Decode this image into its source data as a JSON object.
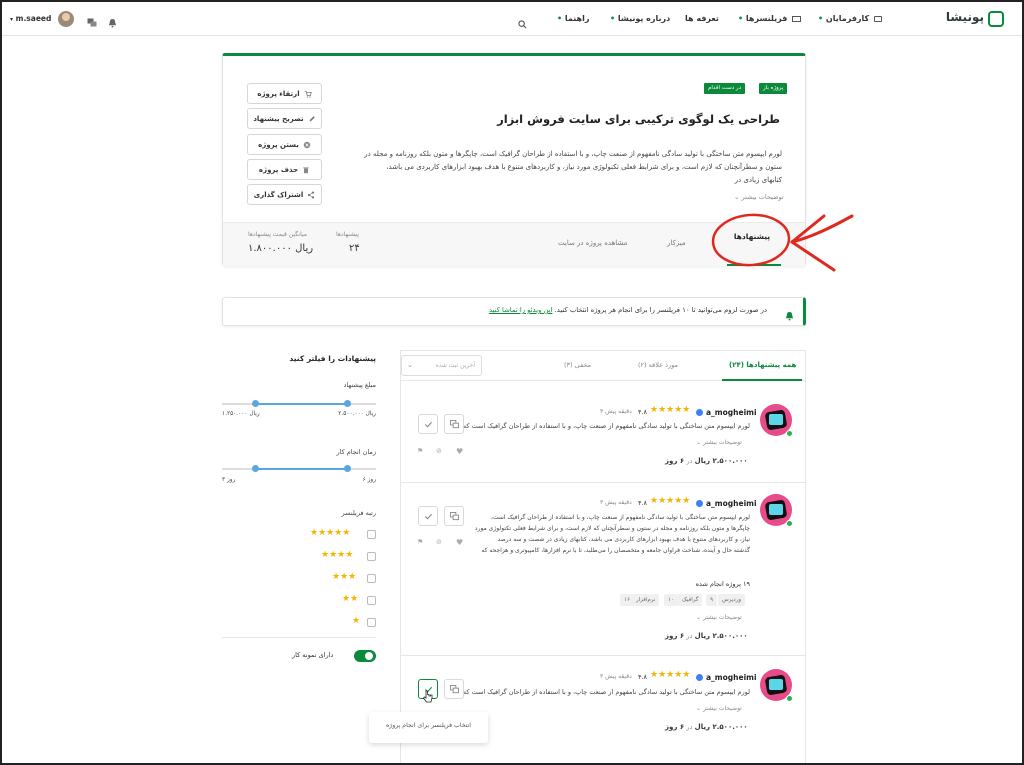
{
  "topbar": {
    "logo": "پونیشا",
    "nav": [
      "کارفرمایان",
      "فریلنسرها",
      "تعرفه ها",
      "درباره پونیشا",
      "راهنما"
    ],
    "username": "m.saeed"
  },
  "project": {
    "badges": [
      "پروژه باز",
      "در دست اقدام"
    ],
    "title": "طراحی یک لوگوی ترکیبی برای سایت فروش ابزار",
    "description": "لورم ایپسوم متن ساختگی با تولید سادگی نامفهوم از صنعت چاپ، و با استفاده از طراحان گرافیک است، چاپگرها و متون بلکه روزنامه و مجله در ستون و سطرآنچنان که لازم است، و برای شرایط فعلی تکنولوژی مورد نیاز، و کاربردهای متنوع با هدف بهبود ابزارهای کاربردی می باشد، کتابهای زیادی در",
    "more": "توضیحات بیشتر",
    "actions": [
      "ارتقاء پروژه",
      "تصریح پیشنهاد",
      "بستن پروژه",
      "حذف پروژه",
      "اشتراک گذاری"
    ],
    "tabs": [
      "پیشنهادها",
      "میزکار",
      "مشاهده پروژه در سایت"
    ],
    "stats": {
      "offers_label": "پیشنهادها",
      "offers_value": "۲۴",
      "avg_label": "میانگین قیمت پیشنهادها",
      "avg_value": "۱.۸۰۰.۰۰۰ ریال"
    }
  },
  "notice": {
    "text": "در صورت لزوم می‌توانید تا ۱۰ فریلنسر را برای انجام هر پروژه انتخاب کنید.",
    "link": "این ویدئو را تماشا کنید"
  },
  "offers": {
    "tabs": [
      "همه پیشنهادها (۲۴)",
      "مورد علاقه (۲)",
      "مخفی (۳)"
    ],
    "sort_placeholder": "آخرین ثبت شده",
    "items": [
      {
        "name": "a_mogheimi",
        "rating": "۴.۸",
        "time": "۳ دقیقه پیش",
        "lines": [
          "لورم ایپسوم متن ساختگی با تولید سادگی نامفهوم از صنعت چاپ، و با استفاده از طراحان گرافیک است که ..."
        ],
        "more": "توضیحات بیشتر",
        "price": "۲.۵۰۰.۰۰۰ ریال",
        "days_prefix": "در",
        "days": "۶ روز"
      },
      {
        "name": "a_mogheimi",
        "rating": "۴.۸",
        "time": "۳ دقیقه پیش",
        "lines": [
          "لورم ایپسوم متن ساختگی با تولید سادگی نامفهوم از صنعت چاپ، و با استفاده از طراحان گرافیک است،",
          "چاپگرها و متون بلکه روزنامه و مجله در ستون و سطرآنچنان که لازم است، و برای شرایط فعلی تکنولوژی مورد",
          "نیاز، و کاربردهای متنوع با هدف بهبود ابزارهای کاربردی می باشد، کتابهای زیادی در شصت و سه درصد",
          "گذشته حال و آینده، شناخت فراوان جامعه و متخصصان را می‌طلبد، تا با نرم افزارها، کامپیوتری و هزاجحه که"
        ],
        "projects_done": "۱۹ پروژه انجام شده",
        "skills": [
          "وردپرس",
          "۹",
          "گرافیک",
          "۱۰",
          "نرم‌افزار",
          "۱۶"
        ],
        "more": "توضیحات بیشتر",
        "price": "۲.۵۰۰.۰۰۰ ریال",
        "days_prefix": "در",
        "days": "۶ روز"
      },
      {
        "name": "a_mogheimi",
        "rating": "۴.۸",
        "time": "۳ دقیقه پیش",
        "lines": [
          "لورم ایپسوم متن ساختگی با تولید سادگی نامفهوم از صنعت چاپ، و با استفاده از طراحان گرافیک است که ..."
        ],
        "more": "توضیحات بیشتر",
        "price": "۲.۵۰۰.۰۰۰ ریال",
        "days_prefix": "در",
        "days": "۶ روز"
      }
    ],
    "tooltip": "انتخاب فریلنسر برای انجام پروژه"
  },
  "filters": {
    "title": "پیشنهادات را فیلتر کنید",
    "price_label": "مبلغ پیشنهاد",
    "price_min": "۲.۵۰۰.۰۰۰ ریال",
    "price_max": "۱.۲۵۰.۰۰۰ ریال",
    "time_label": "زمان انجام کار",
    "time_min": "۶ روز",
    "time_max": "۳ روز",
    "rank_label": "رتبه فریلنسر",
    "stars": [
      5,
      4,
      3,
      2,
      1
    ],
    "sample_label": "دارای نمونه کار"
  },
  "colors": {
    "accent": "#0a8a3a",
    "annotation": "#e0281f",
    "slider": "#5aa7e0"
  }
}
